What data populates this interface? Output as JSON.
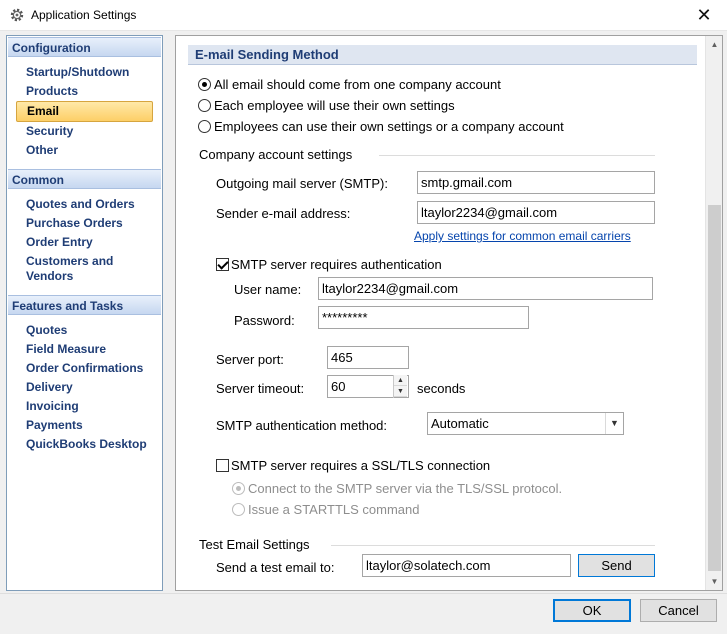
{
  "window": {
    "title": "Application Settings",
    "close_glyph": "✕",
    "app_icon": "gear-icon"
  },
  "sidebar": {
    "groups": [
      {
        "header": "Configuration",
        "items": [
          "Startup/Shutdown",
          "Products",
          "Email",
          "Security",
          "Other"
        ],
        "selected": "Email"
      },
      {
        "header": "Common",
        "items": [
          "Quotes and Orders",
          "Purchase Orders",
          "Order Entry",
          "Customers and Vendors"
        ]
      },
      {
        "header": "Features and Tasks",
        "items": [
          "Quotes",
          "Field Measure",
          "Order Confirmations",
          "Delivery",
          "Invoicing",
          "Payments",
          "QuickBooks Desktop"
        ]
      }
    ]
  },
  "email": {
    "section_title": "E-mail Sending Method",
    "sending_options": [
      {
        "label": "All email should come from one company account",
        "checked": true
      },
      {
        "label": "Each employee will use their own settings",
        "checked": false
      },
      {
        "label": "Employees can use their own settings or a company account",
        "checked": false
      }
    ],
    "company_group_label": "Company account settings",
    "smtp_label": "Outgoing mail server (SMTP):",
    "smtp_value": "smtp.gmail.com",
    "sender_label": "Sender e-mail address:",
    "sender_value": "ltaylor2234@gmail.com",
    "carriers_link": "Apply settings for common email carriers",
    "auth_required_label": "SMTP server requires authentication",
    "auth_required_checked": true,
    "username_label": "User name:",
    "username_value": "ltaylor2234@gmail.com",
    "password_label": "Password:",
    "password_value": "*********",
    "port_label": "Server port:",
    "port_value": "465",
    "timeout_label": "Server timeout:",
    "timeout_value": "60",
    "timeout_units": "seconds",
    "auth_method_label": "SMTP authentication method:",
    "auth_method_value": "Automatic",
    "ssl_label": "SMTP server requires a SSL/TLS connection",
    "ssl_checked": false,
    "ssl_options": [
      {
        "label": "Connect to the SMTP server via the TLS/SSL protocol.",
        "checked": true
      },
      {
        "label": "Issue a STARTTLS command",
        "checked": false
      }
    ],
    "test_group_label": "Test Email Settings",
    "test_label": "Send a test email to:",
    "test_value": "ltaylor@solatech.com",
    "send_button": "Send"
  },
  "footer": {
    "ok_label": "OK",
    "cancel_label": "Cancel"
  },
  "colors": {
    "accent": "#0078d7",
    "nav_text": "#1f3d75",
    "selected_item": "#fdcf67",
    "link": "#0645ad"
  }
}
